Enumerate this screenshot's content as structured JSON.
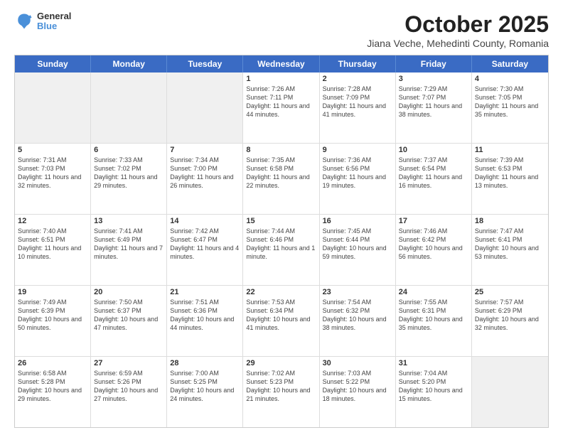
{
  "header": {
    "logo": {
      "general": "General",
      "blue": "Blue"
    },
    "title": "October 2025",
    "subtitle": "Jiana Veche, Mehedinti County, Romania"
  },
  "calendar": {
    "days": [
      "Sunday",
      "Monday",
      "Tuesday",
      "Wednesday",
      "Thursday",
      "Friday",
      "Saturday"
    ],
    "rows": [
      [
        {
          "day": "",
          "info": ""
        },
        {
          "day": "",
          "info": ""
        },
        {
          "day": "",
          "info": ""
        },
        {
          "day": "1",
          "info": "Sunrise: 7:26 AM\nSunset: 7:11 PM\nDaylight: 11 hours and 44 minutes."
        },
        {
          "day": "2",
          "info": "Sunrise: 7:28 AM\nSunset: 7:09 PM\nDaylight: 11 hours and 41 minutes."
        },
        {
          "day": "3",
          "info": "Sunrise: 7:29 AM\nSunset: 7:07 PM\nDaylight: 11 hours and 38 minutes."
        },
        {
          "day": "4",
          "info": "Sunrise: 7:30 AM\nSunset: 7:05 PM\nDaylight: 11 hours and 35 minutes."
        }
      ],
      [
        {
          "day": "5",
          "info": "Sunrise: 7:31 AM\nSunset: 7:03 PM\nDaylight: 11 hours and 32 minutes."
        },
        {
          "day": "6",
          "info": "Sunrise: 7:33 AM\nSunset: 7:02 PM\nDaylight: 11 hours and 29 minutes."
        },
        {
          "day": "7",
          "info": "Sunrise: 7:34 AM\nSunset: 7:00 PM\nDaylight: 11 hours and 26 minutes."
        },
        {
          "day": "8",
          "info": "Sunrise: 7:35 AM\nSunset: 6:58 PM\nDaylight: 11 hours and 22 minutes."
        },
        {
          "day": "9",
          "info": "Sunrise: 7:36 AM\nSunset: 6:56 PM\nDaylight: 11 hours and 19 minutes."
        },
        {
          "day": "10",
          "info": "Sunrise: 7:37 AM\nSunset: 6:54 PM\nDaylight: 11 hours and 16 minutes."
        },
        {
          "day": "11",
          "info": "Sunrise: 7:39 AM\nSunset: 6:53 PM\nDaylight: 11 hours and 13 minutes."
        }
      ],
      [
        {
          "day": "12",
          "info": "Sunrise: 7:40 AM\nSunset: 6:51 PM\nDaylight: 11 hours and 10 minutes."
        },
        {
          "day": "13",
          "info": "Sunrise: 7:41 AM\nSunset: 6:49 PM\nDaylight: 11 hours and 7 minutes."
        },
        {
          "day": "14",
          "info": "Sunrise: 7:42 AM\nSunset: 6:47 PM\nDaylight: 11 hours and 4 minutes."
        },
        {
          "day": "15",
          "info": "Sunrise: 7:44 AM\nSunset: 6:46 PM\nDaylight: 11 hours and 1 minute."
        },
        {
          "day": "16",
          "info": "Sunrise: 7:45 AM\nSunset: 6:44 PM\nDaylight: 10 hours and 59 minutes."
        },
        {
          "day": "17",
          "info": "Sunrise: 7:46 AM\nSunset: 6:42 PM\nDaylight: 10 hours and 56 minutes."
        },
        {
          "day": "18",
          "info": "Sunrise: 7:47 AM\nSunset: 6:41 PM\nDaylight: 10 hours and 53 minutes."
        }
      ],
      [
        {
          "day": "19",
          "info": "Sunrise: 7:49 AM\nSunset: 6:39 PM\nDaylight: 10 hours and 50 minutes."
        },
        {
          "day": "20",
          "info": "Sunrise: 7:50 AM\nSunset: 6:37 PM\nDaylight: 10 hours and 47 minutes."
        },
        {
          "day": "21",
          "info": "Sunrise: 7:51 AM\nSunset: 6:36 PM\nDaylight: 10 hours and 44 minutes."
        },
        {
          "day": "22",
          "info": "Sunrise: 7:53 AM\nSunset: 6:34 PM\nDaylight: 10 hours and 41 minutes."
        },
        {
          "day": "23",
          "info": "Sunrise: 7:54 AM\nSunset: 6:32 PM\nDaylight: 10 hours and 38 minutes."
        },
        {
          "day": "24",
          "info": "Sunrise: 7:55 AM\nSunset: 6:31 PM\nDaylight: 10 hours and 35 minutes."
        },
        {
          "day": "25",
          "info": "Sunrise: 7:57 AM\nSunset: 6:29 PM\nDaylight: 10 hours and 32 minutes."
        }
      ],
      [
        {
          "day": "26",
          "info": "Sunrise: 6:58 AM\nSunset: 5:28 PM\nDaylight: 10 hours and 29 minutes."
        },
        {
          "day": "27",
          "info": "Sunrise: 6:59 AM\nSunset: 5:26 PM\nDaylight: 10 hours and 27 minutes."
        },
        {
          "day": "28",
          "info": "Sunrise: 7:00 AM\nSunset: 5:25 PM\nDaylight: 10 hours and 24 minutes."
        },
        {
          "day": "29",
          "info": "Sunrise: 7:02 AM\nSunset: 5:23 PM\nDaylight: 10 hours and 21 minutes."
        },
        {
          "day": "30",
          "info": "Sunrise: 7:03 AM\nSunset: 5:22 PM\nDaylight: 10 hours and 18 minutes."
        },
        {
          "day": "31",
          "info": "Sunrise: 7:04 AM\nSunset: 5:20 PM\nDaylight: 10 hours and 15 minutes."
        },
        {
          "day": "",
          "info": ""
        }
      ]
    ]
  }
}
